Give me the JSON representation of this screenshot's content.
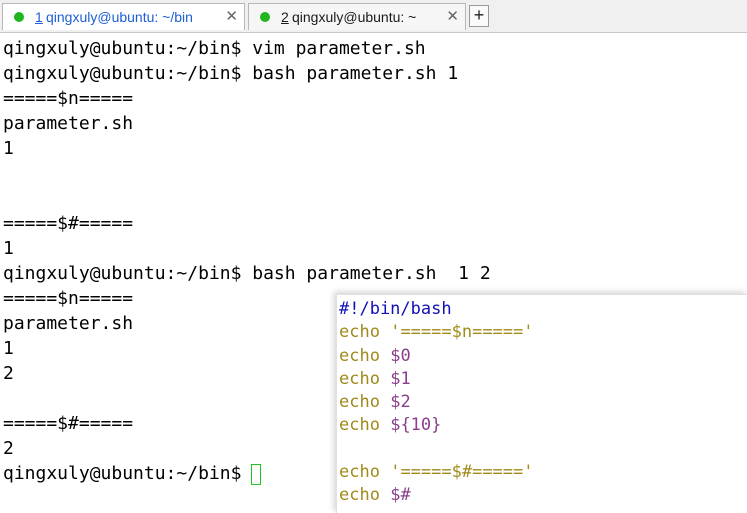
{
  "tabs": [
    {
      "number": "1",
      "title": "qingxuly@ubuntu: ~/bin",
      "close": "✕"
    },
    {
      "number": "2",
      "title": "qingxuly@ubuntu: ~",
      "close": "✕"
    }
  ],
  "new_tab_label": "+",
  "terminal": {
    "lines": [
      "qingxuly@ubuntu:~/bin$ vim parameter.sh",
      "qingxuly@ubuntu:~/bin$ bash parameter.sh 1",
      "=====$n=====",
      "parameter.sh",
      "1",
      "",
      "",
      "=====$#=====",
      "1",
      "qingxuly@ubuntu:~/bin$ bash parameter.sh  1 2",
      "=====$n=====",
      "parameter.sh",
      "1",
      "2",
      "",
      "=====$#=====",
      "2"
    ],
    "prompt": "qingxuly@ubuntu:~/bin$"
  },
  "script_popup": {
    "shebang": "#!/bin/bash",
    "lines": [
      {
        "cmd": "echo",
        "arg": "'=====$n====='",
        "kind": "string"
      },
      {
        "cmd": "echo",
        "arg": "$0",
        "kind": "var"
      },
      {
        "cmd": "echo",
        "arg": "$1",
        "kind": "var"
      },
      {
        "cmd": "echo",
        "arg": "$2",
        "kind": "var"
      },
      {
        "cmd": "echo",
        "arg": "${10}",
        "kind": "var"
      },
      {
        "cmd": "",
        "arg": "",
        "kind": "blank"
      },
      {
        "cmd": "echo",
        "arg": "'=====$#====='",
        "kind": "string"
      },
      {
        "cmd": "echo",
        "arg": "$#",
        "kind": "var"
      }
    ]
  },
  "colors": {
    "tab_dot": "#1fb61f",
    "active_tab_text": "#1e5fd6",
    "cursor": "#1fc21f",
    "shebang": "#1010b8",
    "echo": "#a08a1a",
    "variable": "#8a3f8a"
  }
}
